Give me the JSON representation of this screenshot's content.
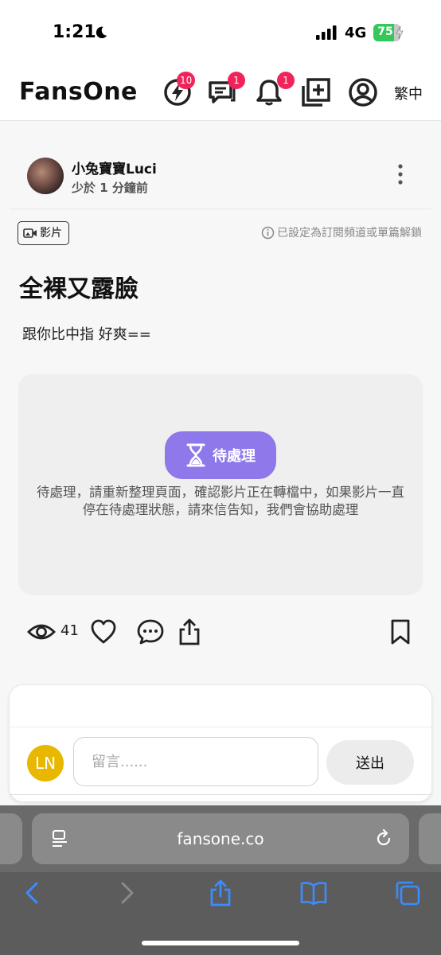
{
  "status_bar": {
    "time": "1:21",
    "network": "4G",
    "battery": "75",
    "battery_level": 0.75
  },
  "header": {
    "logo": "FansOne",
    "icons": [
      {
        "name": "lightning-icon",
        "badge": "10"
      },
      {
        "name": "chat-icon",
        "badge": "1"
      },
      {
        "name": "bell-icon",
        "badge": "1"
      },
      {
        "name": "add-post-icon"
      },
      {
        "name": "profile-icon"
      }
    ],
    "language": "繁中"
  },
  "post": {
    "author": "小兔寶寶Luci",
    "time": "少於 1 分鐘前",
    "type_tag": "影片",
    "unlock_note": "已設定為訂閱頻道或單篇解鎖",
    "title": "全裸又露臉",
    "body": "跟你比中指 好爽==",
    "pending_label": "待處理",
    "pending_message": "待處理，請重新整理頁面，確認影片正在轉檔中，如果影片一直停在待處理狀態，請來信告知，我們會協助處理",
    "views": "41"
  },
  "comment": {
    "avatar_initials": "LN",
    "placeholder": "留言......",
    "send_label": "送出"
  },
  "browser": {
    "url": "fansone.co"
  },
  "colors": {
    "accent": "#8f78ea",
    "badge": "#f0245a",
    "avatar_me": "#e8b800",
    "battery": "#34c759"
  }
}
